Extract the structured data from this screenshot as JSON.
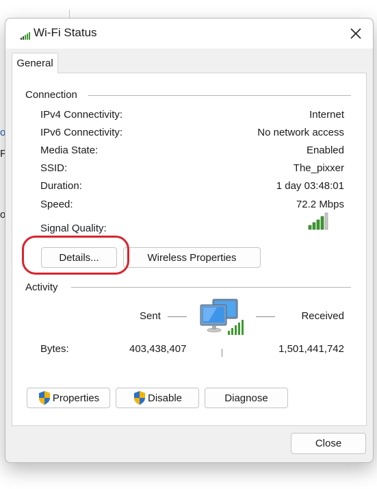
{
  "background_fragments": [
    "or",
    "P",
    "ol"
  ],
  "window": {
    "title": "Wi-Fi Status",
    "close_glyph": "✕"
  },
  "tabs": [
    {
      "label": "General"
    }
  ],
  "connection": {
    "heading": "Connection",
    "rows": [
      {
        "label": "IPv4 Connectivity:",
        "value": "Internet"
      },
      {
        "label": "IPv6 Connectivity:",
        "value": "No network access"
      },
      {
        "label": "Media State:",
        "value": "Enabled"
      },
      {
        "label": "SSID:",
        "value": "The_pixxer"
      },
      {
        "label": "Duration:",
        "value": "1 day 03:48:01"
      },
      {
        "label": "Speed:",
        "value": "72.2 Mbps"
      }
    ],
    "signal_quality_label": "Signal Quality:",
    "signal_bars": 5,
    "details_button": "Details...",
    "wireless_properties_button": "Wireless Properties"
  },
  "activity": {
    "heading": "Activity",
    "sent_label": "Sent",
    "received_label": "Received",
    "bytes_label": "Bytes:",
    "bytes_sent": "403,438,407",
    "bytes_received": "1,501,441,742"
  },
  "actions": {
    "properties_button": "Properties",
    "disable_button": "Disable",
    "diagnose_button": "Diagnose"
  },
  "footer": {
    "close_button": "Close"
  },
  "colors": {
    "highlight": "#d9232e",
    "signal_green": "#3c9a2e",
    "shield_blue": "#2a6fc9",
    "shield_yellow": "#f2b400"
  }
}
